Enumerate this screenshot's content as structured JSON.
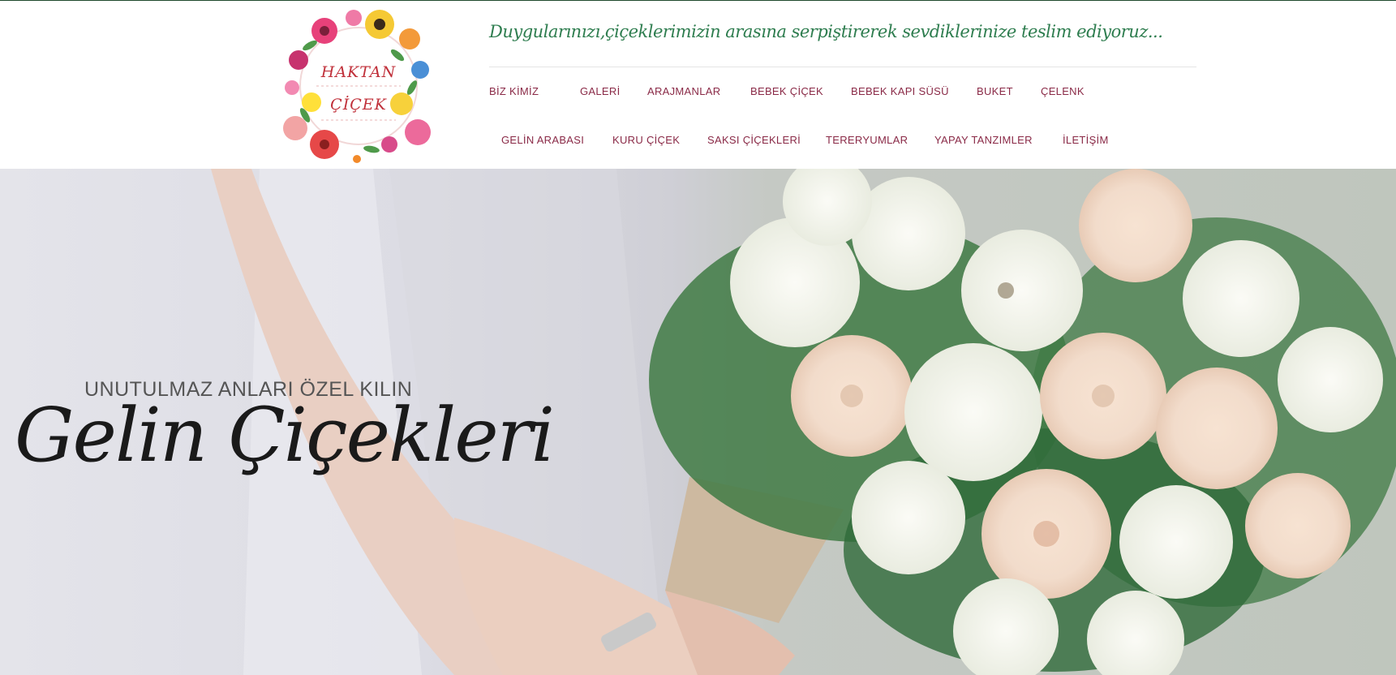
{
  "logo": {
    "line1": "HAKTAN",
    "line2": "ÇİÇEK"
  },
  "tagline": "Duygularınızı,çiçeklerimizin arasına serpiştirerek sevdiklerinize teslim ediyoruz...",
  "nav": {
    "row1": [
      "BİZ KİMİZ",
      "GALERİ",
      "ARAJMANLAR",
      "BEBEK ÇİÇEK",
      "BEBEK KAPI SÜSÜ",
      "BUKET",
      "ÇELENK"
    ],
    "row2": [
      "GELİN ARABASI",
      "KURU ÇİÇEK",
      "SAKSI ÇİÇEKLERİ",
      "TERERYUMLAR",
      "YAPAY TANZIMLER",
      "İLETİŞİM"
    ]
  },
  "hero": {
    "subtitle": "UNUTULMAZ ANLARI ÖZEL KILIN",
    "title": "Gelin Çiçekleri"
  },
  "colors": {
    "nav_text": "#8a2a47",
    "tagline": "#2e7d4f",
    "top_border": "#1f4a2c"
  }
}
